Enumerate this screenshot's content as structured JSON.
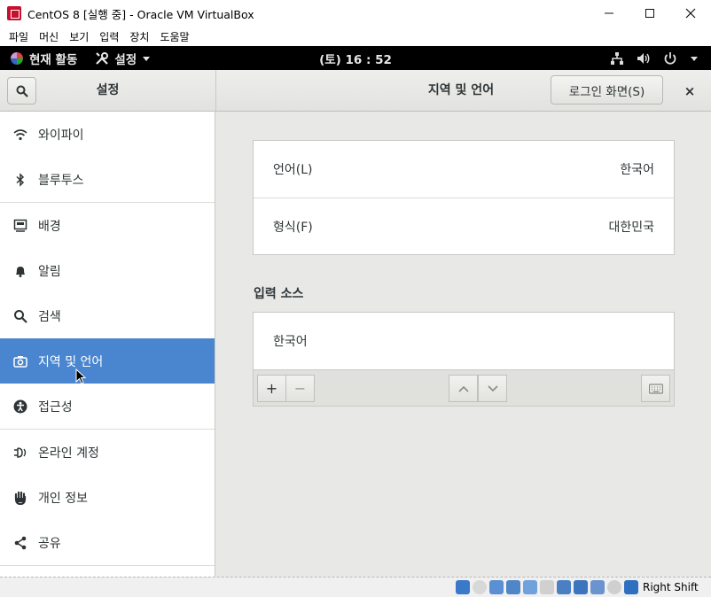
{
  "window": {
    "title": "CentOS 8 [실행 중] - Oracle VM VirtualBox"
  },
  "vbox_menu": [
    "파일",
    "머신",
    "보기",
    "입력",
    "장치",
    "도움말"
  ],
  "gnome": {
    "activities": "현재 활동",
    "app_menu": "설정",
    "clock": "(토) 16 : 52"
  },
  "header": {
    "left_title": "설정",
    "title": "지역 및 언어",
    "login_button": "로그인 화면(S)",
    "close": "×"
  },
  "sidebar": {
    "items": [
      {
        "label": "와이파이",
        "icon": "wifi-icon"
      },
      {
        "label": "블루투스",
        "icon": "bluetooth-icon"
      },
      {
        "label": "배경",
        "icon": "background-icon"
      },
      {
        "label": "알림",
        "icon": "bell-icon"
      },
      {
        "label": "검색",
        "icon": "search-icon"
      },
      {
        "label": "지역 및 언어",
        "icon": "camera-icon",
        "selected": true
      },
      {
        "label": "접근성",
        "icon": "accessibility-icon"
      },
      {
        "label": "온라인 계정",
        "icon": "online-accounts-icon"
      },
      {
        "label": "개인 정보",
        "icon": "hand-icon"
      },
      {
        "label": "공유",
        "icon": "share-icon"
      }
    ]
  },
  "region": {
    "language_label": "언어(L)",
    "language_value": "한국어",
    "formats_label": "형식(F)",
    "formats_value": "대한민국",
    "input_sources_label": "입력 소스",
    "input_sources": [
      "한국어"
    ],
    "add": "+",
    "remove": "−"
  },
  "statusbar": {
    "host_key": "Right Shift"
  },
  "colors": {
    "selected": "#4a86cf",
    "topbar": "#000000",
    "content_bg": "#e8e8e7"
  }
}
